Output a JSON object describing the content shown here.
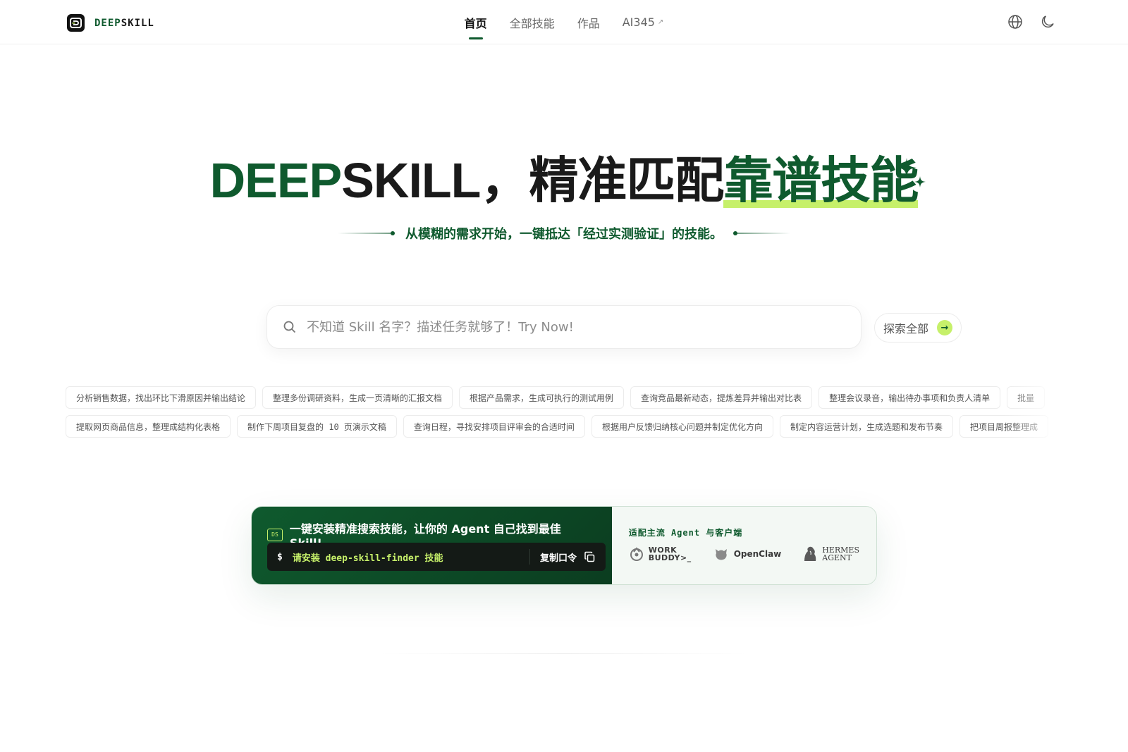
{
  "brand": {
    "name_part1": "DEEP",
    "name_part2": "SKILL"
  },
  "nav": {
    "links": [
      {
        "label": "首页"
      },
      {
        "label": "全部技能"
      },
      {
        "label": "作品"
      },
      {
        "label": "AI345",
        "external_mark": "↗"
      }
    ],
    "icons": [
      "globe-icon",
      "moon-icon"
    ]
  },
  "hero": {
    "title_green": "DEEP",
    "title_dark": "SKILL，精准匹配",
    "title_highlight": "靠谱技能",
    "subtitle": "从模糊的需求开始，一键抵达「经过实测验证」的技能。"
  },
  "search": {
    "placeholder": "不知道 Skill 名字？描述任务就够了！Try Now!",
    "value": ""
  },
  "explore": {
    "label": "探索全部",
    "arrow": "→"
  },
  "chips": {
    "row1": [
      "分析销售数据，找出环比下滑原因并输出结论",
      "整理多份调研资料，生成一页清晰的汇报文档",
      "根据产品需求，生成可执行的测试用例",
      "查询竞品最新动态，提炼差异并输出对比表",
      "整理会议录音，输出待办事项和负责人清单",
      "批量"
    ],
    "row2": [
      "提取网页商品信息，整理成结构化表格",
      "制作下周项目复盘的 10 页演示文稿",
      "查询日程，寻找安排项目评审会的合适时间",
      "根据用户反馈归纳核心问题并制定优化方向",
      "制定内容运营计划，生成选题和发布节奏",
      "把项目周报整理成"
    ]
  },
  "install": {
    "badge": "DS",
    "title": "一键安装精准搜索技能，让你的 Agent 自己找到最佳 Skill!",
    "prompt_symbol": "$",
    "command": "请安装 deep-skill-finder 技能",
    "copy_label": "复制口令",
    "agents_title": "适配主流 Agent 与客户端",
    "agents": [
      {
        "line1": "WORK",
        "line2": "BUDDY>_"
      },
      {
        "name": "OpenClaw"
      },
      {
        "line1": "HERMES",
        "line2": "AGENT"
      }
    ]
  },
  "colors": {
    "brand_green": "#0f5a2e",
    "accent_lime": "#c6f06a",
    "text_dark": "#1a1a1a",
    "muted": "#666666"
  }
}
